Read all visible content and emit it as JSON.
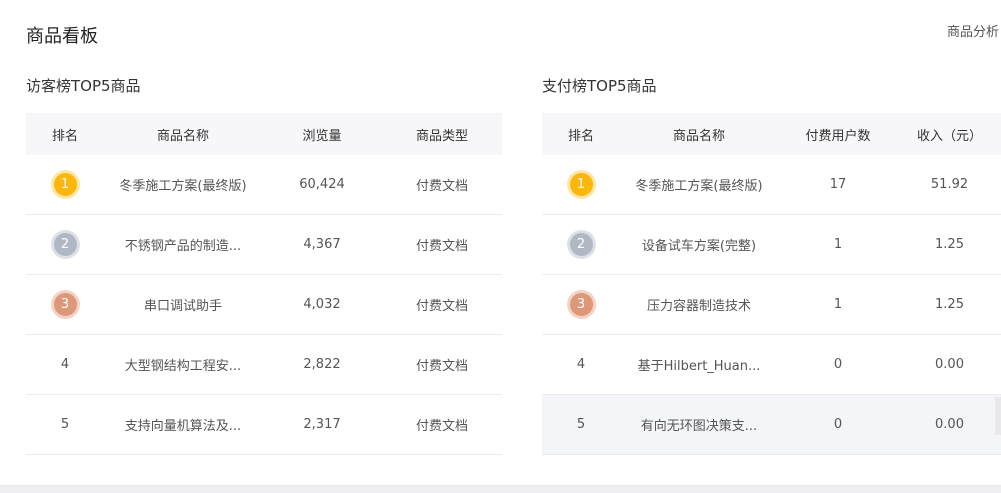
{
  "page": {
    "title": "商品看板",
    "link": "商品分析"
  },
  "colors": {
    "gold": "#fbb70e",
    "silver": "#b0b8c4",
    "bronze": "#dc9878",
    "header_bg": "#f7f7f9",
    "highlight_row": "#f4f5f9"
  },
  "visitor": {
    "title": "访客榜TOP5商品",
    "headers": [
      "排名",
      "商品名称",
      "浏览量",
      "商品类型"
    ],
    "rows": [
      {
        "rank": "1",
        "name": "冬季施工方案(最终版)",
        "views": "60,424",
        "type": "付费文档"
      },
      {
        "rank": "2",
        "name": "不锈钢产品的制造...",
        "views": "4,367",
        "type": "付费文档"
      },
      {
        "rank": "3",
        "name": "串口调试助手",
        "views": "4,032",
        "type": "付费文档"
      },
      {
        "rank": "4",
        "name": "大型钢结构工程安...",
        "views": "2,822",
        "type": "付费文档"
      },
      {
        "rank": "5",
        "name": "支持向量机算法及...",
        "views": "2,317",
        "type": "付费文档"
      }
    ]
  },
  "payment": {
    "title": "支付榜TOP5商品",
    "headers": [
      "排名",
      "商品名称",
      "付费用户数",
      "收入（元）"
    ],
    "rows": [
      {
        "rank": "1",
        "name": "冬季施工方案(最终版)",
        "users": "17",
        "income": "51.92"
      },
      {
        "rank": "2",
        "name": "设备试车方案(完整)",
        "users": "1",
        "income": "1.25"
      },
      {
        "rank": "3",
        "name": "压力容器制造技术",
        "users": "1",
        "income": "1.25"
      },
      {
        "rank": "4",
        "name": "基于Hilbert_Huan...",
        "users": "0",
        "income": "0.00"
      },
      {
        "rank": "5",
        "name": "有向无环图决策支...",
        "users": "0",
        "income": "0.00"
      }
    ]
  }
}
